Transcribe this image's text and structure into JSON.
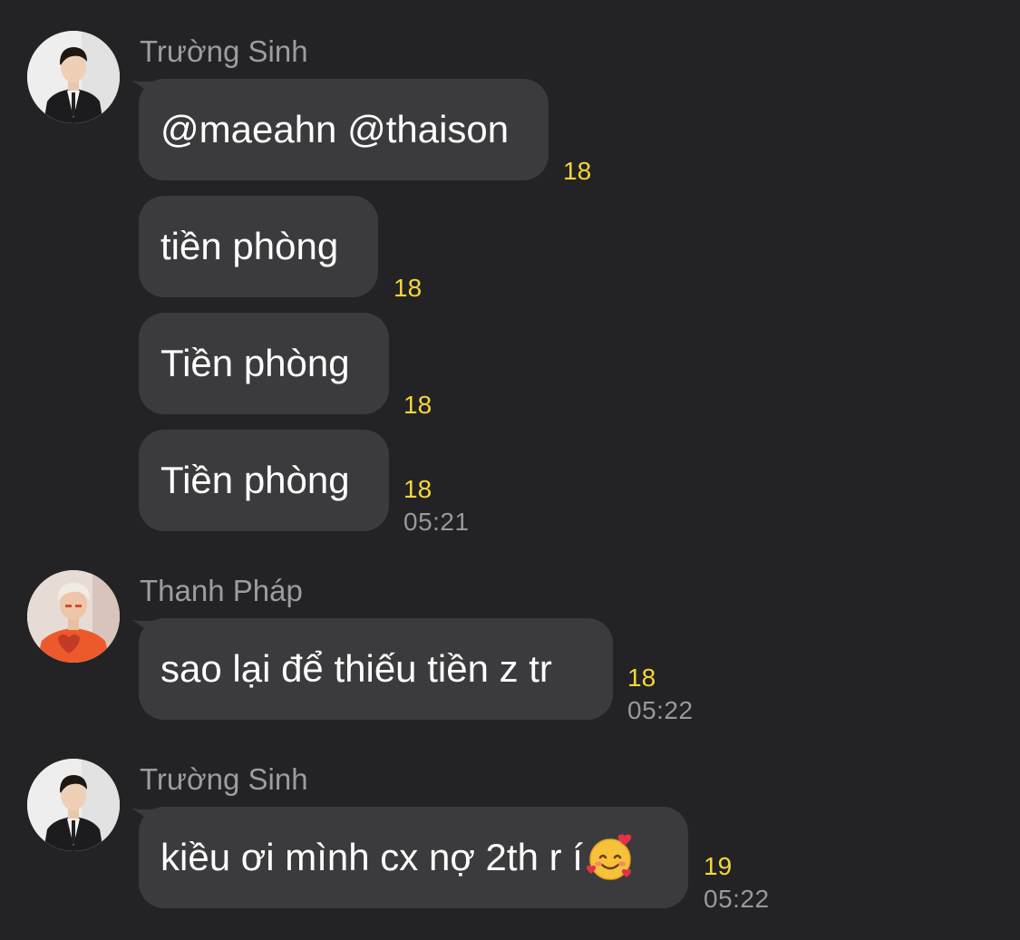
{
  "groups": [
    {
      "sender": "Trường Sinh",
      "messages": [
        {
          "text": "@maeahn @thaison",
          "count": "18",
          "time": ""
        },
        {
          "text": "tiền phòng",
          "count": "18",
          "time": ""
        },
        {
          "text": "Tiền phòng",
          "count": "18",
          "time": ""
        },
        {
          "text": "Tiền phòng",
          "count": "18",
          "time": "05:21"
        }
      ]
    },
    {
      "sender": "Thanh Pháp",
      "messages": [
        {
          "text": "sao lại để thiếu tiền z tr",
          "count": "18",
          "time": "05:22"
        }
      ]
    },
    {
      "sender": "Trường Sinh",
      "messages": [
        {
          "text": "kiều ơi mình cx nợ 2th r í",
          "emoji": "smiling-face-with-hearts-icon",
          "count": "19",
          "time": "05:22"
        }
      ]
    }
  ],
  "colors": {
    "background": "#232325",
    "bubble": "#3b3b3e",
    "count": "#f5d63c",
    "sender": "#9c9ca1",
    "time": "#98989d"
  }
}
